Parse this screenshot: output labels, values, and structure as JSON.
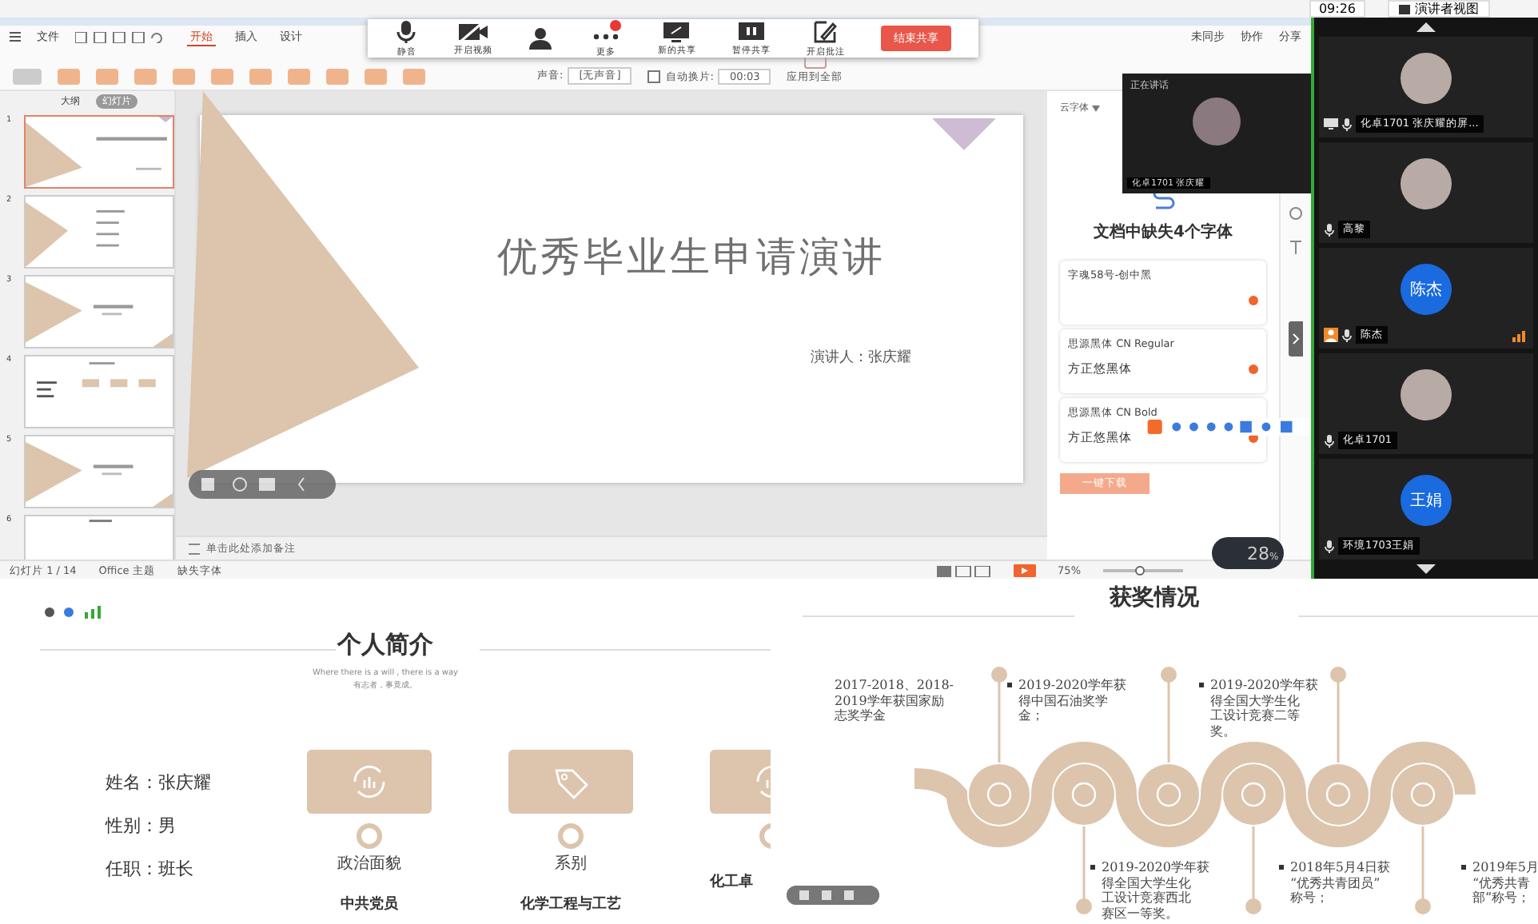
{
  "system_bar": {
    "time": "09:26",
    "view_button": "演讲者视图"
  },
  "menu": {
    "file": "文件",
    "tabs": [
      {
        "label": "开始",
        "selected": true
      },
      {
        "label": "插入",
        "selected": false
      },
      {
        "label": "设计",
        "selected": false
      }
    ],
    "right": [
      "未同步",
      "协作",
      "分享"
    ]
  },
  "meeting_toolbar": {
    "buttons": [
      {
        "kind": "mic",
        "label": "静音"
      },
      {
        "kind": "camera",
        "label": "开启视频"
      },
      {
        "kind": "members"
      },
      {
        "kind": "more",
        "label": "更多"
      },
      {
        "kind": "screen",
        "label": "新的共享"
      },
      {
        "kind": "pause",
        "label": "暂停共享"
      },
      {
        "kind": "pen",
        "label": "开启批注"
      }
    ],
    "end_button": "结束共享"
  },
  "ribbon": {
    "sound_label": "声音:",
    "sound_value": "[无声音]",
    "auto_label": "自动换片:",
    "auto_checked": false,
    "auto_time": "00:03",
    "apply_all": "应用到全部"
  },
  "slide_panel": {
    "tabs": [
      {
        "label": "大纲",
        "selected": false
      },
      {
        "label": "幻灯片",
        "selected": true
      }
    ],
    "thumbnails": [
      {
        "number": "1",
        "kind": "title",
        "selected": true
      },
      {
        "number": "2",
        "kind": "contents",
        "selected": false
      },
      {
        "number": "3",
        "kind": "part",
        "selected": false
      },
      {
        "number": "4",
        "kind": "profile",
        "selected": false
      },
      {
        "number": "5",
        "kind": "part",
        "selected": false
      },
      {
        "number": "6",
        "kind": "blank",
        "selected": false
      }
    ]
  },
  "slide": {
    "title": "优秀毕业生申请演讲",
    "presenter": "演讲人：张庆耀",
    "notes_placeholder": "单击此处添加备注"
  },
  "status_bar": {
    "slide_count": "幻灯片 1 / 14",
    "theme": "Office 主题",
    "missing_fonts": "缺失字体",
    "zoom": "75%",
    "zoom_slider": {
      "level": 0.45
    }
  },
  "font_panel": {
    "tab": "云字体",
    "heading": "文档中缺失4个字体",
    "fonts": [
      {
        "name": "字魂58号-创中黑"
      },
      {
        "name": "思源黑体 CN Regular",
        "replacement": "方正悠黑体"
      },
      {
        "name": "思源黑体 CN Bold",
        "replacement": "方正悠黑体"
      }
    ],
    "download_button": "一键下载"
  },
  "speaker_window": {
    "title": "正在讲话",
    "name": "化卓1701 张庆耀"
  },
  "participants": [
    {
      "name": "化卓1701 张庆耀的屏...",
      "kind": "photo",
      "sharing": true,
      "host": false
    },
    {
      "name": "高黎",
      "kind": "photo",
      "sharing": false,
      "host": false
    },
    {
      "name": "陈杰",
      "kind": "initials",
      "avatar_text": "陈杰",
      "sharing": false,
      "host": true
    },
    {
      "name": "化卓1701",
      "kind": "photo",
      "sharing": false,
      "host": false
    },
    {
      "name": "环境1703王娟",
      "kind": "initials",
      "avatar_text": "王娟",
      "sharing": false,
      "host": false
    }
  ],
  "network_badge": {
    "value": "28",
    "unit": "%"
  },
  "profile_slide": {
    "title": "个人简介",
    "motto": "Where there is a will , there is a way",
    "motto_cn": "有志者，事竟成。",
    "facts": [
      "姓名：张庆耀",
      "性别：男",
      "任职：班长"
    ],
    "cards": [
      {
        "kind": "chart",
        "label": "政治面貌",
        "value": "中共党员"
      },
      {
        "kind": "tag",
        "label": "系别",
        "value": "化学工程与工艺"
      },
      {
        "kind": "chart",
        "value": "化工卓"
      }
    ]
  },
  "awards_slide": {
    "title": "获奖情况",
    "top": [
      {
        "bullet": false,
        "lines": [
          "2017-2018、2018-",
          "2019学年获国家励",
          "志奖学金"
        ]
      },
      {
        "bullet": true,
        "lines": [
          "2019-2020学年获",
          "得中国石油奖学",
          "金；"
        ]
      },
      {
        "bullet": true,
        "lines": [
          "2019-2020学年获",
          "得全国大学生化",
          "工设计竞赛二等",
          "奖。"
        ]
      }
    ],
    "bottom": [
      {
        "bullet": true,
        "lines": [
          "2019-2020学年获",
          "得全国大学生化",
          "工设计竞赛西北",
          "赛区一等奖。"
        ]
      },
      {
        "bullet": true,
        "lines": [
          "2018年5月4日获",
          "“优秀共青团员”",
          "称号；"
        ]
      },
      {
        "bullet": true,
        "lines": [
          "2019年5月",
          "“优秀共青",
          "部”称号；"
        ]
      }
    ]
  }
}
